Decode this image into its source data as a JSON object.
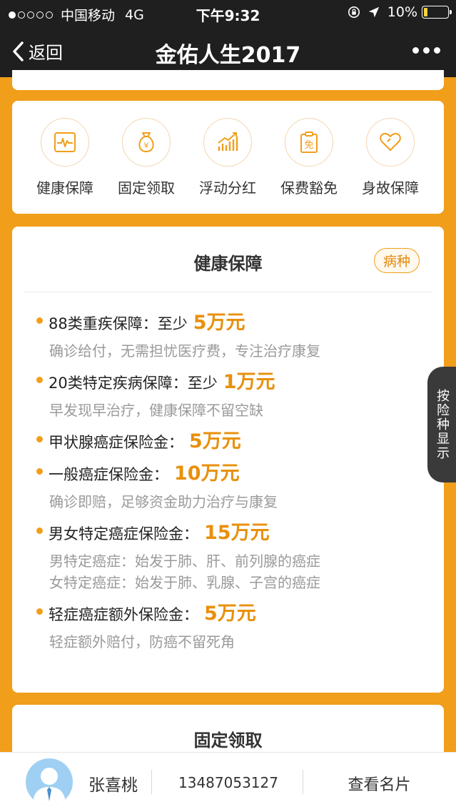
{
  "status_bar": {
    "carrier": "中国移动",
    "network": "4G",
    "time": "下午9:32",
    "battery": "10%"
  },
  "nav": {
    "back_label": "返回",
    "title": "金佑人生2017"
  },
  "features": [
    {
      "label": "健康保障",
      "icon": "heartbeat-icon"
    },
    {
      "label": "固定领取",
      "icon": "money-bag-icon"
    },
    {
      "label": "浮动分红",
      "icon": "bar-chart-icon"
    },
    {
      "label": "保费豁免",
      "icon": "waiver-icon"
    },
    {
      "label": "身故保障",
      "icon": "heart-icon"
    }
  ],
  "health": {
    "title": "健康保障",
    "tag": "病种",
    "items": [
      {
        "label": "88类重疾保障：至少",
        "amount": "5万元",
        "desc": [
          "确诊给付，无需担忧医疗费，专注治疗康复"
        ]
      },
      {
        "label": "20类特定疾病保障：至少",
        "amount": "1万元",
        "desc": [
          "早发现早治疗，健康保障不留空缺"
        ]
      },
      {
        "label": "甲状腺癌症保险金：",
        "amount": "5万元",
        "desc": []
      },
      {
        "label": "一般癌症保险金：",
        "amount": "10万元",
        "desc": [
          "确诊即赔，足够资金助力治疗与康复"
        ]
      },
      {
        "label": "男女特定癌症保险金：",
        "amount": "15万元",
        "desc": [
          "男特定癌症：始发于肺、肝、前列腺的癌症",
          "女特定癌症：始发于肺、乳腺、子宫的癌症"
        ]
      },
      {
        "label": "轻症癌症额外保险金：",
        "amount": "5万元",
        "desc": [
          "轻症额外赔付，防癌不留死角"
        ]
      }
    ]
  },
  "side_tab": "按险种显示",
  "fixed": {
    "title": "固定领取"
  },
  "agent": {
    "name": "张喜桃",
    "phone": "13487053127",
    "card_label": "查看名片"
  },
  "colors": {
    "accent": "#F19E1A",
    "amount": "#E8900C",
    "bar": "#1F1F1F"
  }
}
